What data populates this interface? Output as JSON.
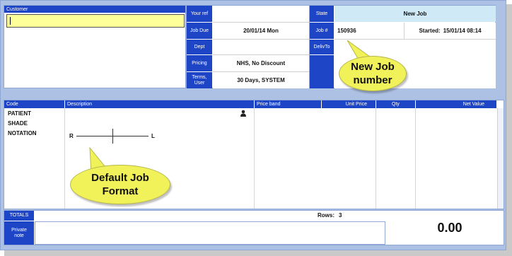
{
  "customer": {
    "label": "Customer",
    "value": ""
  },
  "job_fields": [
    {
      "label": "Your ref",
      "value": ""
    },
    {
      "label": "Job Due",
      "value": "20/01/14  Mon"
    },
    {
      "label": "Dept",
      "value": ""
    },
    {
      "label": "Pricing",
      "value": "NHS, No Discount"
    },
    {
      "label": "Terms, User",
      "value": "30 Days, SYSTEM"
    }
  ],
  "status": {
    "state_label": "State",
    "state_value": "New Job",
    "job_no_label": "Job #",
    "job_no_value": "150936",
    "started_label": "Started:",
    "started_value": "15/01/14  08:14",
    "delivto_label": "DelivTo",
    "delivto_value": ""
  },
  "grid": {
    "columns": [
      "Code",
      "Description",
      "Price band",
      "Unit Price",
      "Qty",
      "Net Value"
    ],
    "rows": [
      {
        "code": "PATIENT"
      },
      {
        "code": "SHADE"
      },
      {
        "code": "NOTATION"
      }
    ],
    "diagram_left": "R",
    "diagram_right": "L"
  },
  "footer": {
    "totals_label": "TOTALS",
    "rows_label": "Rows:",
    "rows_value": "3",
    "private_note_label": "Private note",
    "private_note_value": "",
    "total_value": "0.00"
  },
  "callouts": {
    "new_job": "New Job number",
    "default_job": "Default Job Format"
  },
  "colors": {
    "label_blue": "#1f45c7",
    "highlight_yellow": "#ffff99",
    "callout_yellow": "#f1f15a",
    "frame": "#adc1e4"
  }
}
